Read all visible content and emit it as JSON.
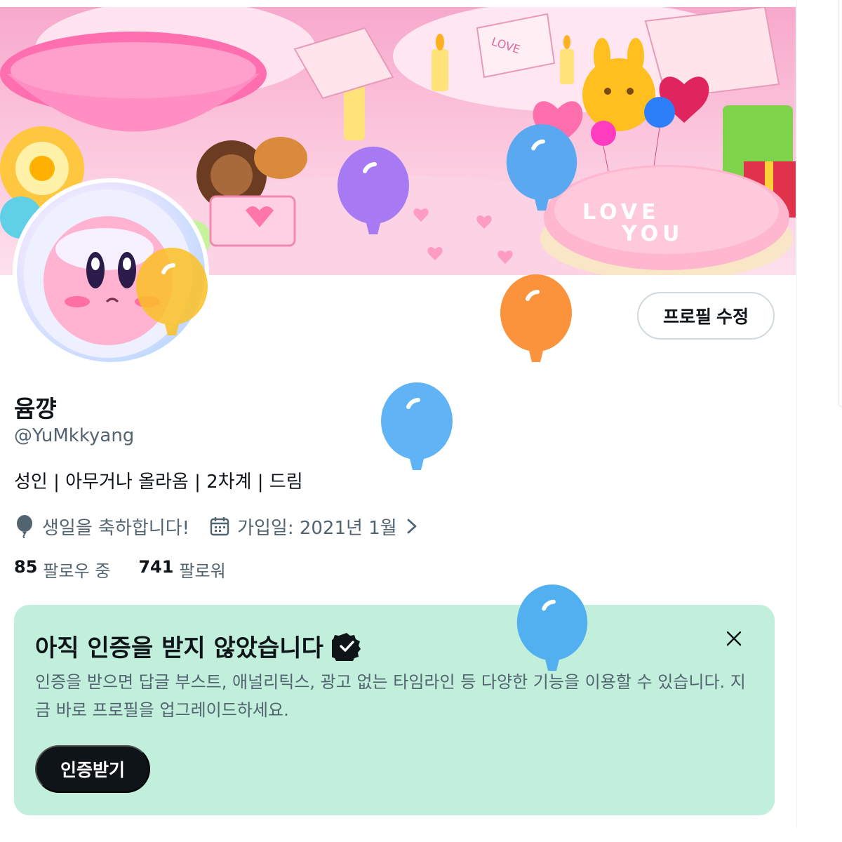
{
  "profile": {
    "display_name": "윰꺙",
    "handle": "@YuMkkyang",
    "bio": "성인 | 아무거나 올라옴 | 2차계 | 드림",
    "birthday_text": "생일을 축하합니다!",
    "joined_text": "가입일: 2021년 1월",
    "following_count": "85",
    "following_label": "팔로우 중",
    "followers_count": "741",
    "followers_label": "팔로워",
    "edit_button_label": "프로필 수정"
  },
  "banner": {
    "love_sign": "LOVE",
    "love_sign_2": "YOU",
    "envelope_text": "LOVE"
  },
  "verify_card": {
    "title": "아직 인증을 받지 않았습니다",
    "body": "인증을 받으면 답글 부스트, 애널리틱스, 광고 없는 타임라인 등 다양한 기능을 이용할 수 있습니다. 지금 바로 프로필을 업그레이드하세요.",
    "button_label": "인증받기",
    "background": "#c1efdc"
  },
  "balloons": [
    {
      "color": "#a779f2"
    },
    {
      "color": "#5aa8f0"
    },
    {
      "color": "#fbbf24"
    },
    {
      "color": "#fb923c"
    },
    {
      "color": "#60b4f6"
    },
    {
      "color": "#52aff0"
    }
  ],
  "icons": {
    "birthday": "balloon-icon",
    "joined": "calendar-icon",
    "chevron": "chevron-right-icon",
    "close": "close-icon",
    "verified": "verified-badge-icon"
  }
}
